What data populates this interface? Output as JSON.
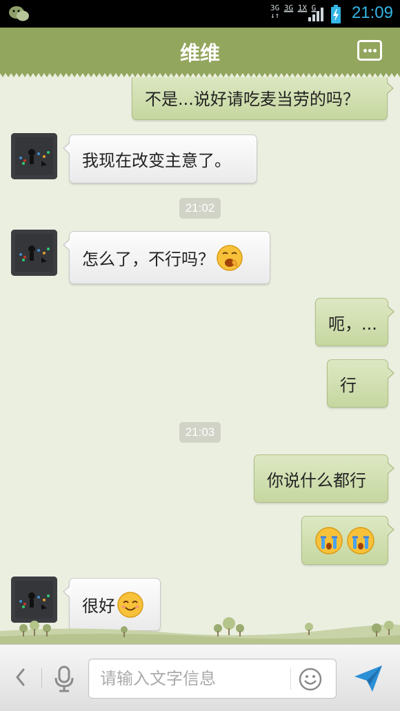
{
  "status_bar": {
    "time": "21:09",
    "network_labels": [
      "3G",
      "3G",
      "1X",
      "G"
    ],
    "accent_color": "#33b5e5"
  },
  "header": {
    "title": "维维",
    "bar_color": "#93a65e"
  },
  "messages": [
    {
      "direction": "out",
      "text": "不是...说好请吃麦当劳的吗？"
    },
    {
      "direction": "in",
      "text": "我现在改变主意了。"
    },
    {
      "type": "timestamp",
      "text": "21:02"
    },
    {
      "direction": "in",
      "text": "怎么了，不行吗？",
      "emoji": [
        "yawn-emoji"
      ]
    },
    {
      "direction": "out",
      "text": "呃，..."
    },
    {
      "direction": "out",
      "text": "行"
    },
    {
      "type": "timestamp",
      "text": "21:03"
    },
    {
      "direction": "out",
      "text": "你说什么都行"
    },
    {
      "direction": "out",
      "text": "",
      "emoji": [
        "crying-emoji",
        "crying-emoji"
      ]
    },
    {
      "direction": "in",
      "text": "很好",
      "emoji": [
        "smile-emoji"
      ]
    }
  ],
  "input_bar": {
    "placeholder": "请输入文字信息",
    "icons": [
      "back-chevron-icon",
      "microphone-icon",
      "smiley-icon",
      "send-icon"
    ]
  },
  "colors": {
    "chat_background": "#ebefe0",
    "outgoing_bubble": "#d2e0b2",
    "incoming_bubble": "#f4f4f4",
    "send_icon": "#2b8fd6"
  }
}
